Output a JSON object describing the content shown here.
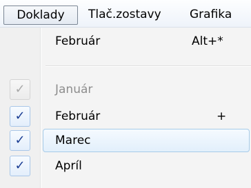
{
  "menubar": {
    "items": [
      {
        "label": "Doklady"
      },
      {
        "label": "Tlač.zostavy"
      },
      {
        "label": "Grafika"
      }
    ]
  },
  "dropdown": {
    "top_item": {
      "label": "Február",
      "shortcut": "Alt+*"
    },
    "months": [
      {
        "label": "Január",
        "checked": true,
        "enabled": false,
        "shortcut": ""
      },
      {
        "label": "Február",
        "checked": true,
        "enabled": true,
        "shortcut": "+"
      },
      {
        "label": "Marec",
        "checked": true,
        "enabled": true,
        "shortcut": "",
        "highlighted": true
      },
      {
        "label": "Apríl",
        "checked": true,
        "enabled": true,
        "shortcut": ""
      }
    ],
    "check_glyph": "✓"
  }
}
